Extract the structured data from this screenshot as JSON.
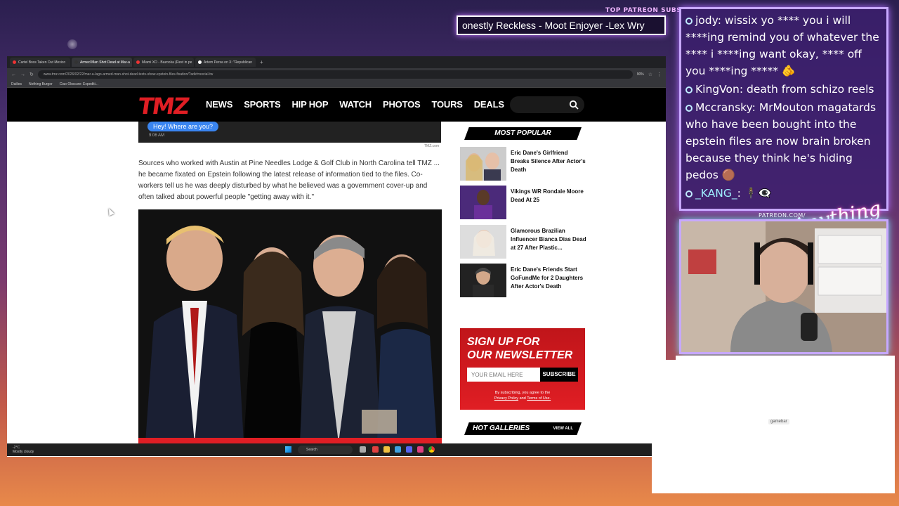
{
  "overlay": {
    "patreon_title": "TOP PATREON SUBS",
    "ticker_text": "onestly Reckless - Moot Enjoyer -Lex Wry",
    "patreon_url": "PATREON.COM/",
    "brand": "Anything else?"
  },
  "browser": {
    "tabs": [
      {
        "label": "Cartel Boss Taken Out Mexico"
      },
      {
        "label": "Armed Man Shot Dead at Mar-a"
      },
      {
        "label": "Miami XO - Bazooka (Rest in pe"
      },
      {
        "label": "Artem Persa on X: \"Republican"
      }
    ],
    "url": "www.tmz.com/2026/02/22/mar-a-lago-armed-man-shot-dead-texts-show-epstein-files-fixation/?adid=social-tw",
    "zoom": "90%",
    "bookmarks": [
      "Dailies",
      "Nothing Burger",
      "Ciao Obscure: Expediti..."
    ]
  },
  "tmz": {
    "logo": "TMZ",
    "nav": [
      "NEWS",
      "SPORTS",
      "HIP HOP",
      "WATCH",
      "PHOTOS",
      "TOURS",
      "DEALS"
    ]
  },
  "article": {
    "chat_bubble": "Hey! Where are you?",
    "chat_time": "9:06 AM",
    "credit": "TMZ.com",
    "paragraph": "Sources who worked with Austin at Pine Needles Lodge & Golf Club in North Carolina tell TMZ ... he became fixated on Epstein following the latest release of information tied to the files. Co-workers tell us he was deeply disturbed by what he believed was a government cover-up and often talked about powerful people \"getting away with it.\""
  },
  "sidebar": {
    "most_popular_title": "MOST POPULAR",
    "items": [
      {
        "title": "Eric Dane's Girlfriend Breaks Silence After Actor's Death"
      },
      {
        "title": "Vikings WR Rondale Moore Dead At 25"
      },
      {
        "title": "Glamorous Brazilian Influencer Bianca Dias Dead at 27 After Plastic..."
      },
      {
        "title": "Eric Dane's Friends Start GoFundMe for 2 Daughters After Actor's Death"
      }
    ],
    "newsletter": {
      "heading_1": "SIGN UP FOR",
      "heading_2": "OUR NEWSLETTER",
      "placeholder": "YOUR EMAIL HERE",
      "button": "SUBSCRIBE",
      "fine_1": "By subscribing, you agree to the",
      "fine_privacy": "Privacy Policy",
      "fine_and": "and",
      "fine_terms": "Terms of Use."
    },
    "hot_galleries_title": "HOT GALLERIES",
    "view_all": "VIEW ALL"
  },
  "taskbar": {
    "weather_temp": "-2°C",
    "weather_desc": "Mostly cloudy",
    "search": "Search"
  },
  "chat": [
    {
      "user": "jody",
      "message": "wissix yo **** you i will ****ing remind you of whatever the **** i ****ing want okay, **** off you ****ing ***** 🫵"
    },
    {
      "user": "KingVon",
      "message": "death from schizo reels"
    },
    {
      "user": "Mccransky",
      "message": "MrMouton magatards who have been bought into the epstein files are now brain broken because they think he's hiding pedos 🟤"
    },
    {
      "user": "_KANG_",
      "message": "🕴️👁️‍🗨️"
    }
  ],
  "gamebar": "gamebar"
}
